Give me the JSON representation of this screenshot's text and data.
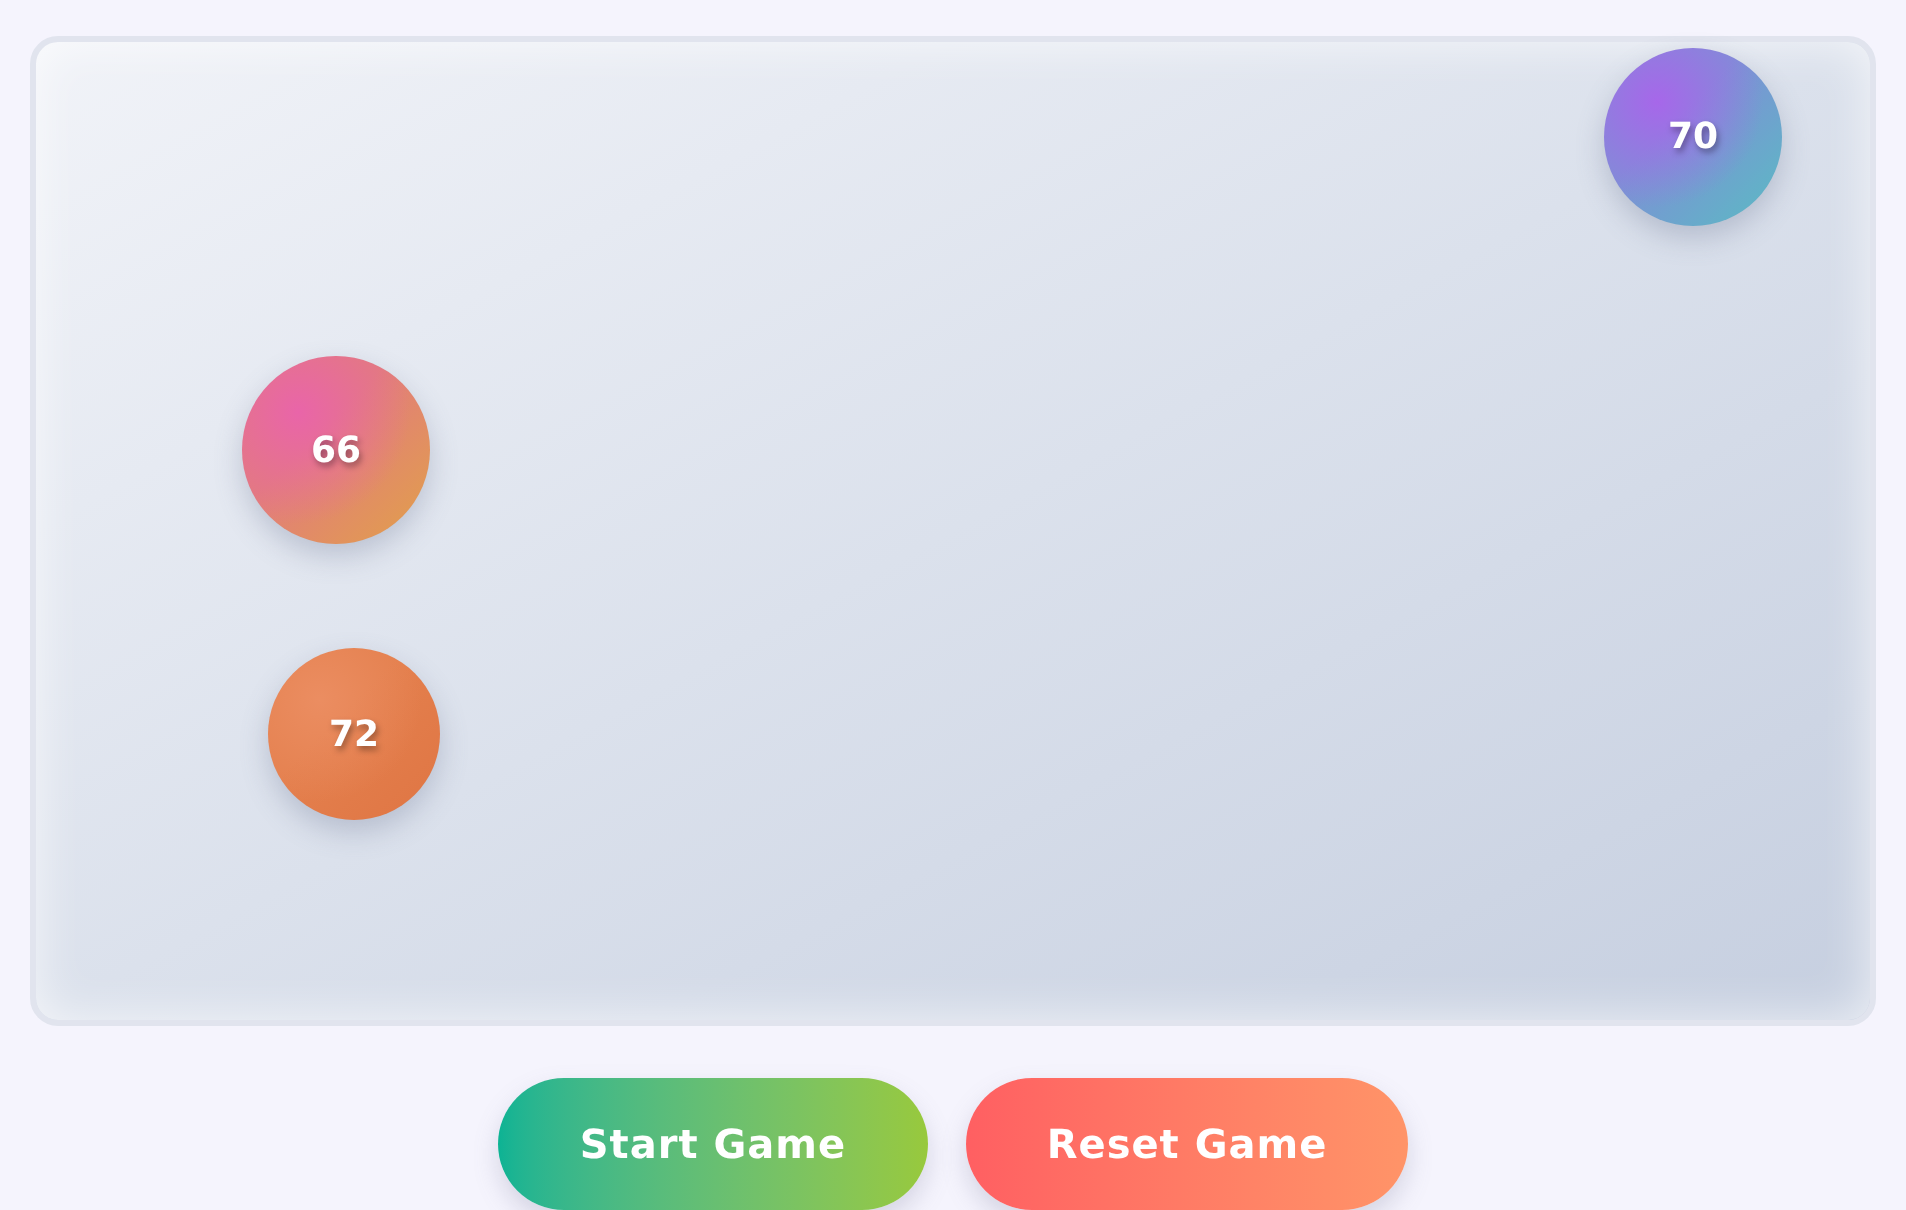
{
  "game_area": {
    "balls": [
      {
        "label": "70",
        "color": "#7e8fd6"
      },
      {
        "label": "66",
        "color": "#e27c7c"
      },
      {
        "label": "72",
        "color": "#e4804e"
      }
    ]
  },
  "buttons": [
    {
      "label": "Start Game",
      "kind": "start"
    },
    {
      "label": "Reset Game",
      "kind": "reset"
    }
  ]
}
